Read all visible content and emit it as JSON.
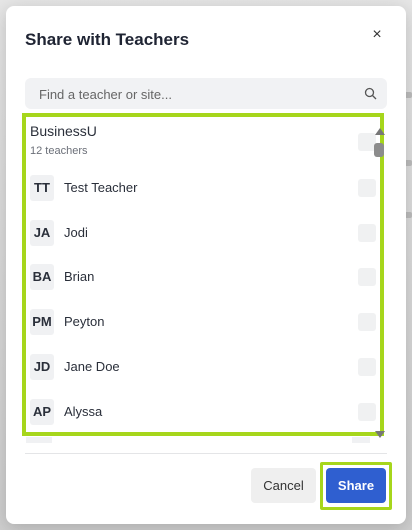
{
  "dialog": {
    "title": "Share with Teachers",
    "close_glyph": "×"
  },
  "search": {
    "placeholder": "Find a teacher or site...",
    "icon": "search-icon"
  },
  "group": {
    "name": "BusinessU",
    "count_label": "12 teachers"
  },
  "teachers": [
    {
      "initials": "TT",
      "name": "Test Teacher"
    },
    {
      "initials": "JA",
      "name": "Jodi"
    },
    {
      "initials": "BA",
      "name": "Brian"
    },
    {
      "initials": "PM",
      "name": "Peyton"
    },
    {
      "initials": "JD",
      "name": "Jane Doe"
    },
    {
      "initials": "AP",
      "name": "Alyssa"
    }
  ],
  "actions": {
    "cancel_label": "Cancel",
    "share_label": "Share"
  },
  "colors": {
    "highlight": "#a6d61b",
    "primary": "#2f5fd0"
  }
}
